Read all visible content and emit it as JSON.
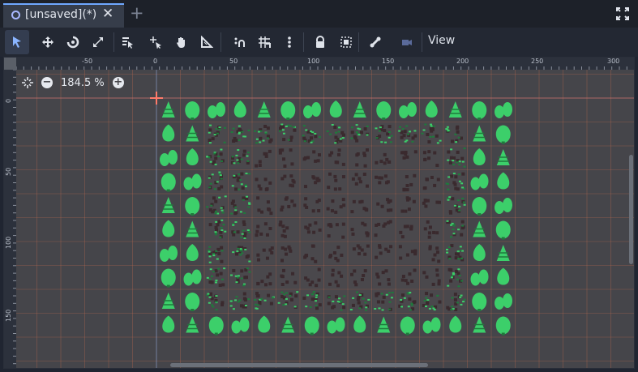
{
  "tabs": {
    "active_label": "[unsaved](*)",
    "close_glyph": "✕",
    "add_glyph": "+"
  },
  "toolbar": {
    "tools": [
      {
        "name": "select-mode-icon",
        "active": true
      },
      {
        "name": "move-mode-icon"
      },
      {
        "name": "rotate-mode-icon"
      },
      {
        "name": "scale-mode-icon"
      },
      {
        "name": "list-select-icon"
      },
      {
        "name": "pivot-mode-icon"
      },
      {
        "name": "pan-mode-icon"
      },
      {
        "name": "ruler-mode-icon"
      },
      {
        "name": "smart-snap-icon"
      },
      {
        "name": "grid-snap-icon"
      },
      {
        "name": "snap-options-icon"
      },
      {
        "name": "lock-icon"
      },
      {
        "name": "group-icon"
      },
      {
        "name": "skeleton-icon"
      },
      {
        "name": "camera-override-icon"
      }
    ],
    "view_label": "View"
  },
  "viewport": {
    "zoom_level": "184.5 %",
    "zoom_out_glyph": "−",
    "zoom_in_glyph": "+",
    "ruler_x_labels": [
      "-50",
      "0",
      "50",
      "100",
      "150",
      "200",
      "250",
      "300"
    ],
    "ruler_y_labels": [
      "0",
      "50",
      "100",
      "150"
    ],
    "colors": {
      "canvas": "#45454a",
      "grid": "#c06a4f",
      "tree": "#3ccf6a",
      "tree_dark": "#1f7a3c",
      "dirt": "#3a2a2e",
      "ground": "#4a484c"
    },
    "tilemap": {
      "cols": 15,
      "rows": 10,
      "legend": "T=tree, G=grassy-dirt, D=dirt",
      "layout": [
        "TTTTTTTTTTTTTTT",
        "TTGGGGGGGGGGGTT",
        "TTGGDDDDDDDDGTT",
        "TTGGDDDDDDDDGTT",
        "TTGGDDDDDDDDGTT",
        "TTGGDDDDDDDDGTT",
        "TTGGDDDDDDDDGTT",
        "TTGGDDDDDDDDGTT",
        "TTGGGGGGGGGGGTT",
        "TTTTTTTTTTTTTTT"
      ]
    }
  }
}
